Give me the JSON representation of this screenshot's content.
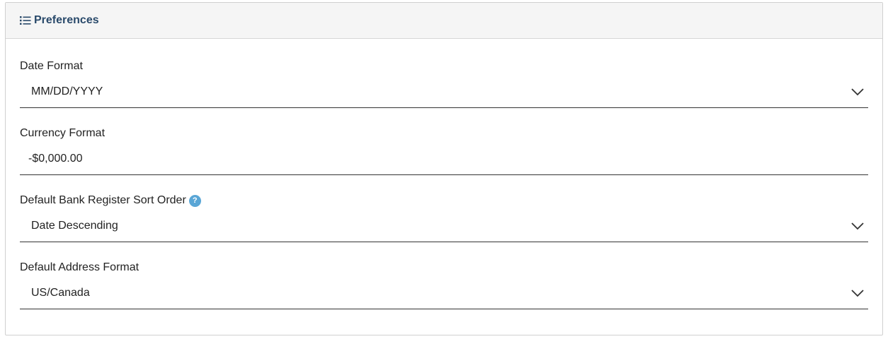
{
  "panel": {
    "title": "Preferences",
    "icon": "list-icon"
  },
  "fields": [
    {
      "label": "Date Format",
      "value": "MM/DD/YYYY",
      "type": "select",
      "icon": "chevron-down-icon"
    },
    {
      "label": "Currency Format",
      "value": "-$0,000.00",
      "type": "text"
    },
    {
      "label": "Default Bank Register Sort Order",
      "value": "Date Descending",
      "type": "select",
      "icon": "chevron-down-icon",
      "help_icon": "help-icon",
      "help_glyph": "?"
    },
    {
      "label": "Default Address Format",
      "value": "US/Canada",
      "type": "select",
      "icon": "chevron-down-icon"
    }
  ],
  "colors": {
    "title": "#2a4a6b",
    "help_icon": "#5aa6d6",
    "header_bg": "#f5f5f5"
  }
}
